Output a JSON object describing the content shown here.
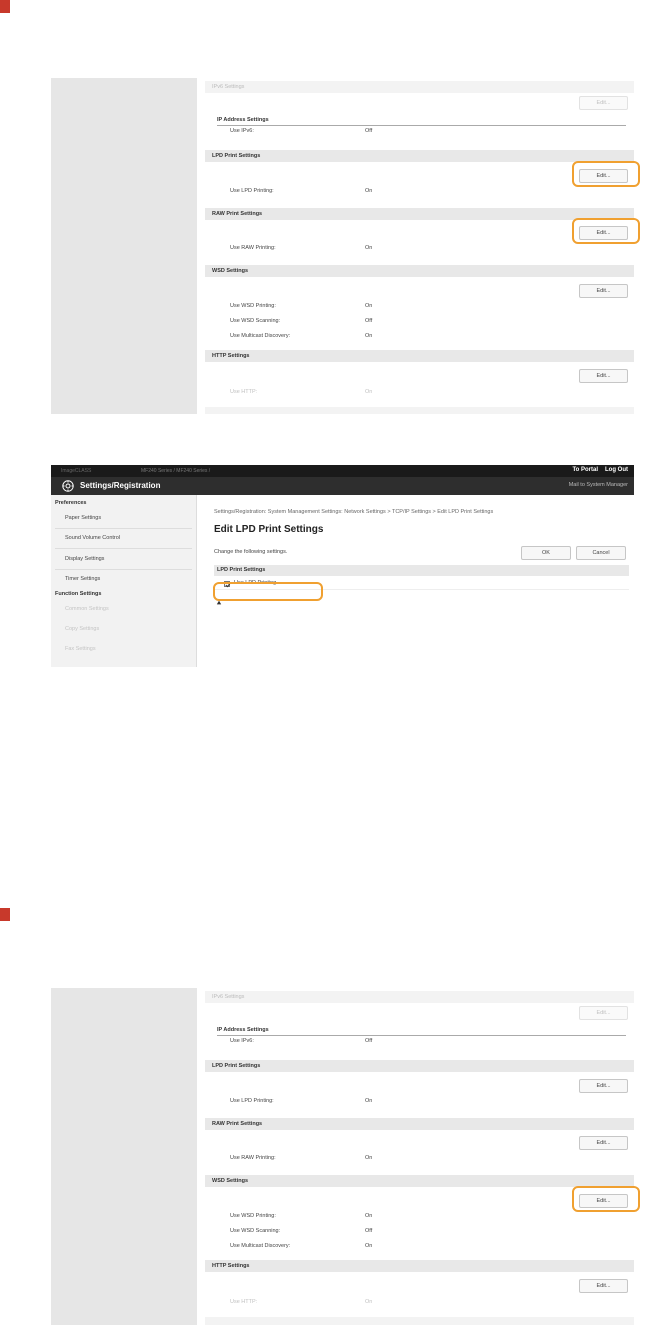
{
  "panel_edit_button": "Edit...",
  "network_panel": {
    "ipv6_header": "IPv6 Settings",
    "ip_address_heading": "IP Address Settings",
    "use_ipv6_label": "Use IPv6:",
    "use_ipv6_value": "Off",
    "lpd_header": "LPD Print Settings",
    "use_lpd_label": "Use LPD Printing:",
    "use_lpd_value": "On",
    "raw_header": "RAW Print Settings",
    "use_raw_label": "Use RAW Printing:",
    "use_raw_value": "On",
    "wsd_header": "WSD Settings",
    "wsd_printing_label": "Use WSD Printing:",
    "wsd_printing_value": "On",
    "wsd_scanning_label": "Use WSD Scanning:",
    "wsd_scanning_value": "Off",
    "multicast_label": "Use Multicast Discovery:",
    "multicast_value": "On",
    "http_header": "HTTP Settings",
    "use_http_label": "Use HTTP:",
    "use_http_value": "On"
  },
  "remote_ui": {
    "top_bar": {
      "device_name": "ImageCLASS",
      "series": "MF240 Series / MF240 Series /",
      "to_portal": "To Portal",
      "log_out": "Log Out"
    },
    "header": {
      "title": "Settings/Registration",
      "mail_link": "Mail to System Manager"
    },
    "nav": {
      "preferences_label": "Preferences",
      "preferences_items": [
        "Paper Settings",
        "Sound Volume Control",
        "Display Settings",
        "Timer Settings"
      ],
      "function_label": "Function Settings",
      "function_items": [
        "Common Settings",
        "Copy Settings",
        "Fax Settings"
      ]
    },
    "breadcrumb": "Settings/Registration: System Management Settings: Network Settings > TCP/IP Settings > Edit LPD Print Settings",
    "page_title": "Edit LPD Print Settings",
    "instruction": "Change the following settings.",
    "ok_button": "OK",
    "cancel_button": "Cancel",
    "section_header": "LPD Print Settings",
    "checkbox_label": "Use LPD Printing",
    "checkbox_checked": true
  },
  "colors": {
    "step_marker": "#c8392b",
    "highlight": "#f0a030",
    "header_bg": "#2e2e2e"
  }
}
